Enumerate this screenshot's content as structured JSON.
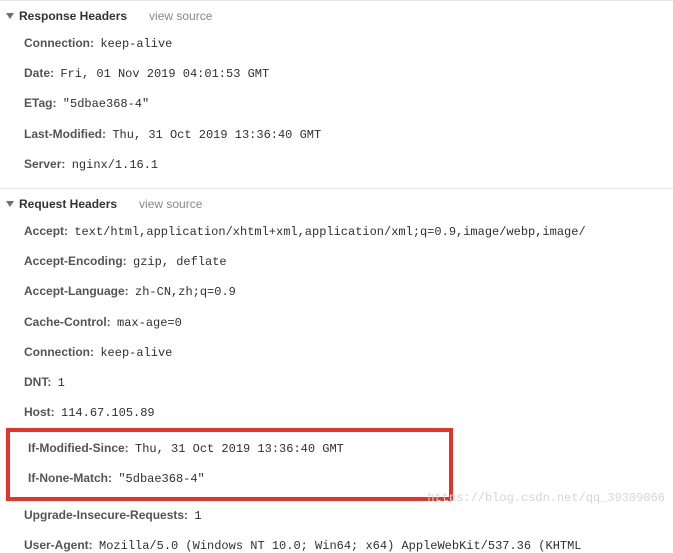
{
  "sections": {
    "response": {
      "title": "Response Headers",
      "view_source": "view source",
      "headers": [
        {
          "name": "Connection:",
          "value": "keep-alive"
        },
        {
          "name": "Date:",
          "value": "Fri, 01 Nov 2019 04:01:53 GMT"
        },
        {
          "name": "ETag:",
          "value": "\"5dbae368-4\""
        },
        {
          "name": "Last-Modified:",
          "value": "Thu, 31 Oct 2019 13:36:40 GMT"
        },
        {
          "name": "Server:",
          "value": "nginx/1.16.1"
        }
      ]
    },
    "request": {
      "title": "Request Headers",
      "view_source": "view source",
      "headers_top": [
        {
          "name": "Accept:",
          "value": "text/html,application/xhtml+xml,application/xml;q=0.9,image/webp,image/"
        },
        {
          "name": "Accept-Encoding:",
          "value": "gzip, deflate"
        },
        {
          "name": "Accept-Language:",
          "value": "zh-CN,zh;q=0.9"
        },
        {
          "name": "Cache-Control:",
          "value": "max-age=0"
        },
        {
          "name": "Connection:",
          "value": "keep-alive"
        },
        {
          "name": "DNT:",
          "value": "1"
        },
        {
          "name": "Host:",
          "value": "114.67.105.89"
        }
      ],
      "headers_highlight": [
        {
          "name": "If-Modified-Since:",
          "value": "Thu, 31 Oct 2019 13:36:40 GMT"
        },
        {
          "name": "If-None-Match:",
          "value": "\"5dbae368-4\""
        }
      ],
      "headers_bottom": [
        {
          "name": "Upgrade-Insecure-Requests:",
          "value": "1"
        },
        {
          "name": "User-Agent:",
          "value": "Mozilla/5.0 (Windows NT 10.0; Win64; x64) AppleWebKit/537.36 (KHTML"
        }
      ]
    }
  },
  "watermark": "https://blog.csdn.net/qq_39309066"
}
